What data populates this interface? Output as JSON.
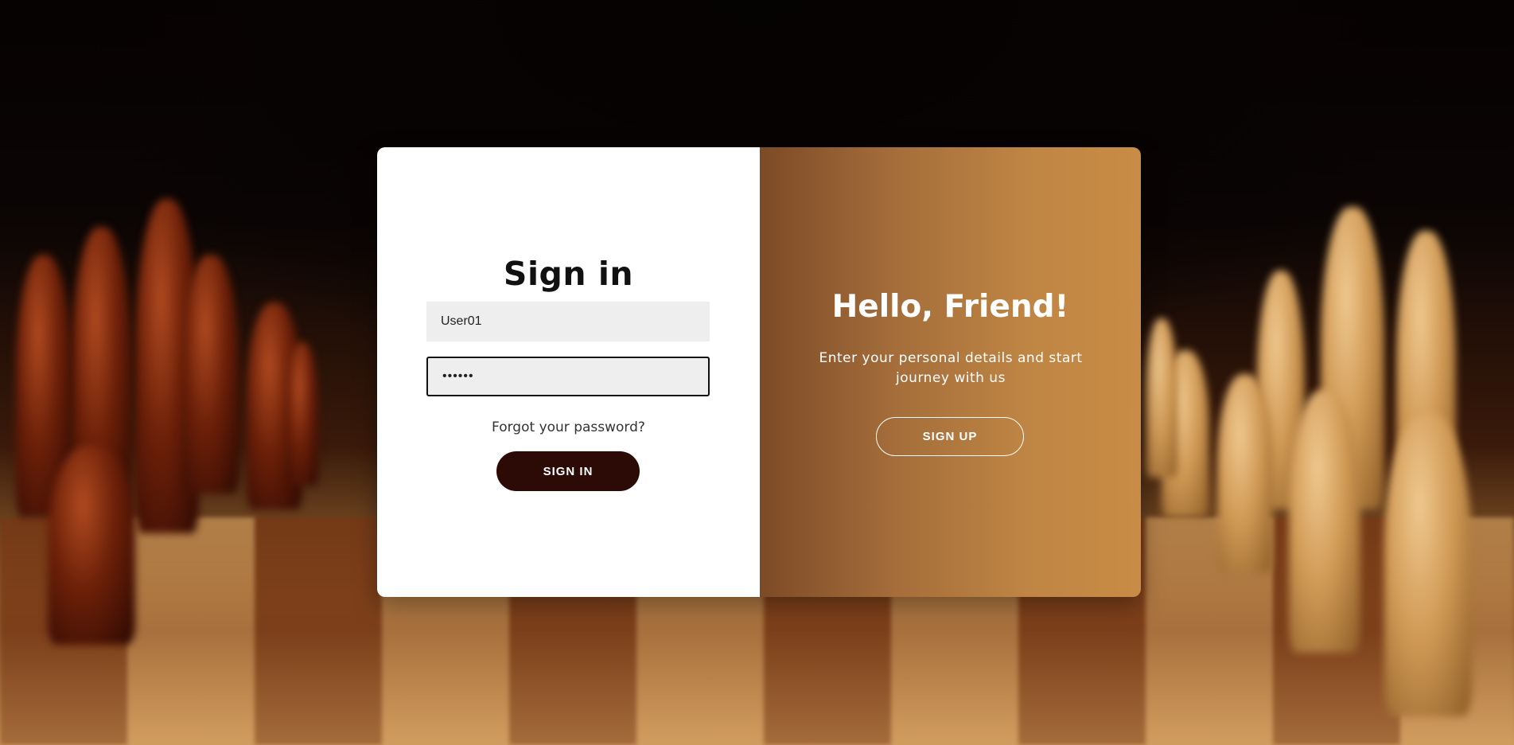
{
  "signin": {
    "title": "Sign in",
    "username_value": "User01",
    "password_value": "••••••",
    "forgot_link": "Forgot your password?",
    "signin_button": "SIGN IN"
  },
  "overlay": {
    "title": "Hello, Friend!",
    "description": "Enter your personal details and start journey with us",
    "signup_button": "SIGN UP"
  },
  "colors": {
    "signin_button_bg": "#2c0b06",
    "overlay_gradient_start": "#7c4a26",
    "overlay_gradient_end": "#c98c46"
  }
}
